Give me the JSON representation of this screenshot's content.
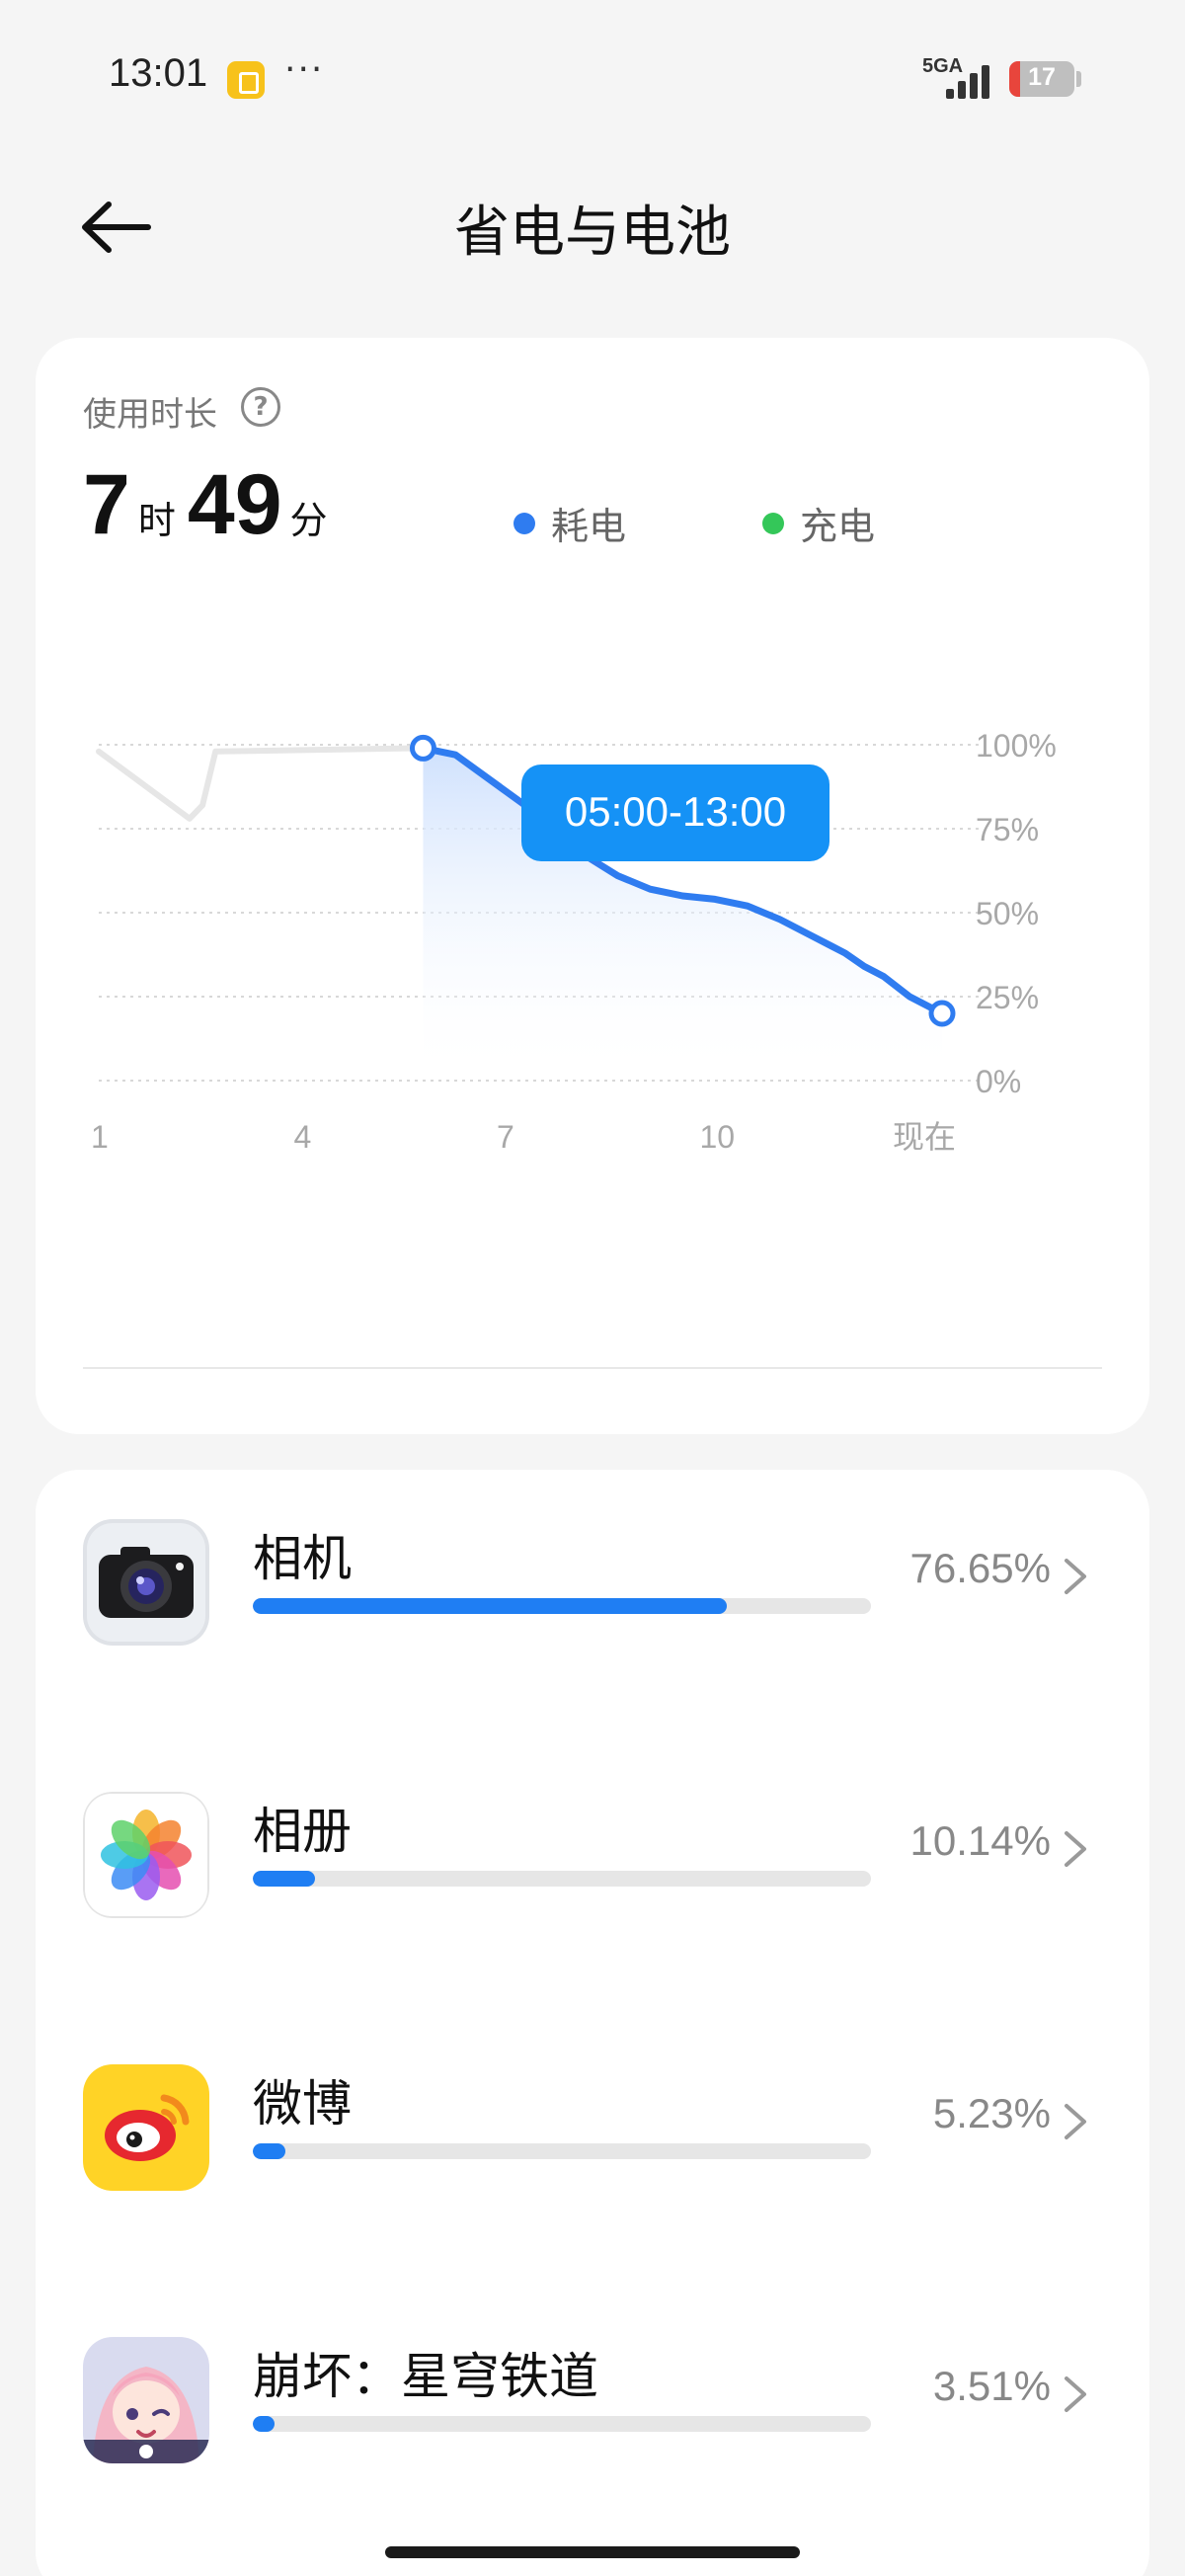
{
  "status_bar": {
    "time": "13:01",
    "notification_icon": "app-notification-icon",
    "more_indicator": "···",
    "network": "5GA",
    "battery_level": "17",
    "battery_fill": 0.17,
    "battery_color": "#e8453c"
  },
  "header": {
    "back_icon": "arrow-left-icon",
    "title": "省电与电池"
  },
  "usage": {
    "label": "使用时长",
    "help_icon": "question-circle-icon",
    "hours": "7",
    "hours_unit": "时",
    "minutes": "49",
    "minutes_unit": "分",
    "legend": [
      {
        "label": "耗电",
        "color": "#2f7cf0"
      },
      {
        "label": "充电",
        "color": "#34c759"
      }
    ]
  },
  "chart_data": {
    "type": "line",
    "x_ticks": [
      "1",
      "4",
      "7",
      "10",
      "现在"
    ],
    "y_ticks": [
      "100%",
      "75%",
      "50%",
      "25%",
      "0%"
    ],
    "ylim": [
      0,
      100
    ],
    "xlim": [
      0,
      13
    ],
    "grid": true,
    "tooltip": "05:00-13:00",
    "series": [
      {
        "color": "#e6e6e6",
        "x": [
          0,
          1.4,
          1.6,
          1.8,
          5.0
        ],
        "y": [
          98,
          78,
          82,
          98,
          99
        ]
      },
      {
        "color": "#2f7cf0",
        "x": [
          5.0,
          5.5,
          6.0,
          6.5,
          7.0,
          7.5,
          8.0,
          8.5,
          9.0,
          9.5,
          10.0,
          10.5,
          11.0,
          11.3,
          11.5,
          11.8,
          12.1,
          12.5,
          13.0
        ],
        "y": [
          99,
          97,
          90,
          83,
          76,
          67,
          61,
          57,
          55,
          54,
          52,
          48,
          43,
          40,
          38,
          34,
          31,
          25,
          20
        ]
      }
    ]
  },
  "apps": [
    {
      "name": "相机",
      "percent": "76.65%",
      "fraction": 0.7665,
      "icon": "camera-app-icon"
    },
    {
      "name": "相册",
      "percent": "10.14%",
      "fraction": 0.1014,
      "icon": "gallery-app-icon"
    },
    {
      "name": "微博",
      "percent": "5.23%",
      "fraction": 0.0523,
      "icon": "weibo-app-icon"
    },
    {
      "name": "崩坏：星穹铁道",
      "percent": "3.51%",
      "fraction": 0.0351,
      "icon": "honkai-star-rail-app-icon"
    }
  ]
}
